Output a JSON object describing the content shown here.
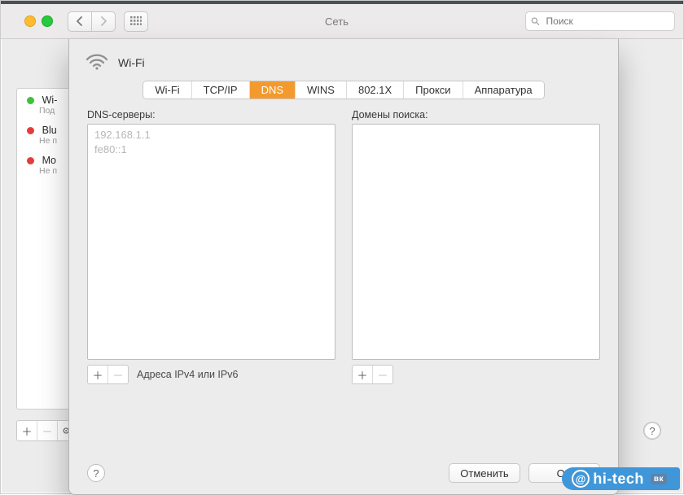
{
  "window": {
    "title": "Сеть",
    "search_placeholder": "Поиск"
  },
  "sidebar": {
    "items": [
      {
        "dot": "green",
        "title": "Wi-",
        "sub": "Под"
      },
      {
        "dot": "red",
        "title": "Blu",
        "sub": "Не п"
      },
      {
        "dot": "red",
        "title": "Mo",
        "sub": "Не п"
      }
    ]
  },
  "sheet": {
    "title": "Wi-Fi",
    "tabs": [
      "Wi-Fi",
      "TCP/IP",
      "DNS",
      "WINS",
      "802.1X",
      "Прокси",
      "Аппаратура"
    ],
    "active_tab_index": 2,
    "dns": {
      "label": "DNS-серверы:",
      "entries": [
        "192.168.1.1",
        "fe80::1"
      ],
      "hint": "Адреса IPv4 или IPv6"
    },
    "domains": {
      "label": "Домены поиска:",
      "entries": []
    },
    "buttons": {
      "cancel": "Отменить",
      "ok": "OK"
    }
  },
  "watermark": {
    "text": "hi-tech",
    "badge": "вк"
  },
  "colors": {
    "accent": "#f39a2e"
  }
}
